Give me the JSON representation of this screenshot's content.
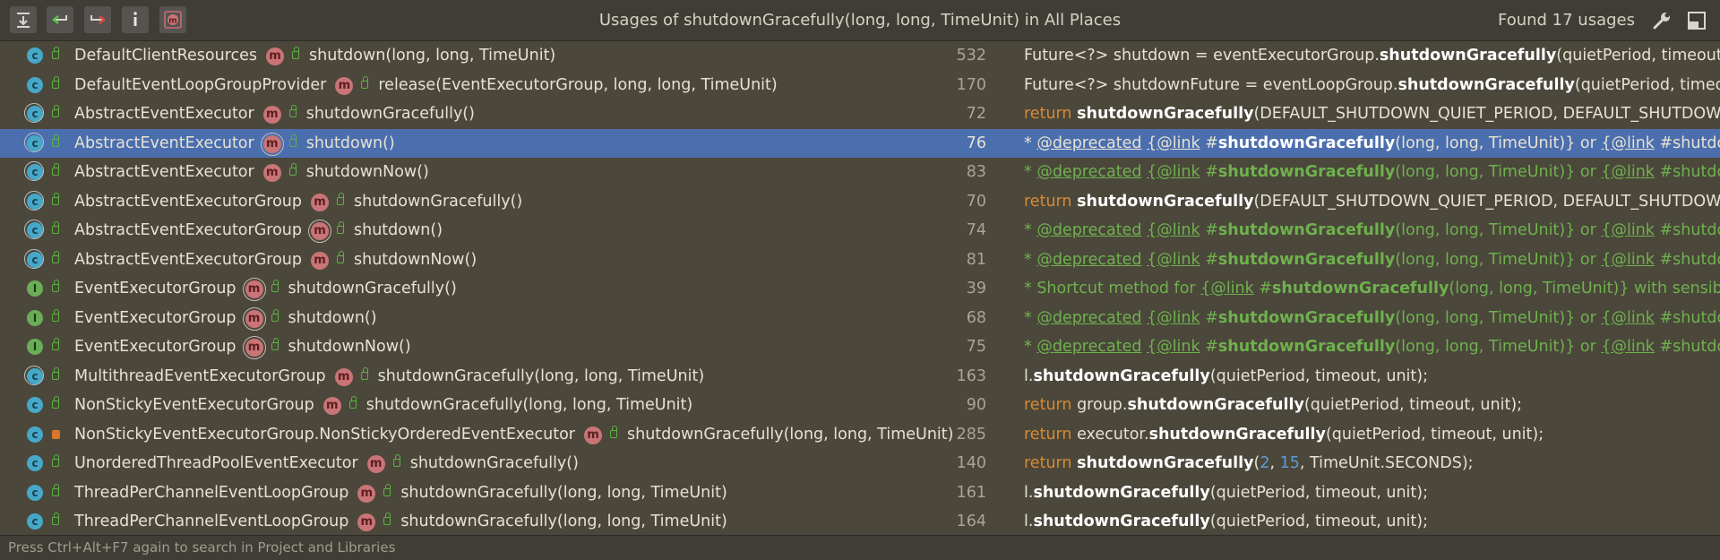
{
  "header": {
    "title": "Usages of shutdownGracefully(long, long, TimeUnit) in All Places",
    "found": "Found 17 usages",
    "toolbar": [
      {
        "name": "expand-all-icon"
      },
      {
        "name": "previous-occurrence-icon"
      },
      {
        "name": "next-occurrence-icon"
      },
      {
        "name": "info-icon"
      },
      {
        "name": "filter-method-icon"
      }
    ],
    "settings_icon": "wrench-icon",
    "pin_icon": "restore-layout-icon"
  },
  "rows": [
    {
      "icon": "c",
      "ab": false,
      "lock": "green",
      "cls": "DefaultClientResources",
      "micon_ab": false,
      "method": "shutdown(long, long, TimeUnit)",
      "line": "532",
      "code": [
        {
          "t": "Future<?> shutdown = eventExecutorGroup."
        },
        {
          "t": "shutdownGracefully",
          "s": "bold"
        },
        {
          "t": "(quietPeriod, timeout, timeUnit);"
        }
      ]
    },
    {
      "icon": "c",
      "ab": false,
      "lock": "green",
      "cls": "DefaultEventLoopGroupProvider",
      "micon_ab": false,
      "method": "release(EventExecutorGroup, long, long, TimeUnit)",
      "line": "170",
      "code": [
        {
          "t": "Future<?> shutdownFuture = eventLoopGroup."
        },
        {
          "t": "shutdownGracefully",
          "s": "bold"
        },
        {
          "t": "(quietPeriod, timeout, unit);"
        }
      ]
    },
    {
      "icon": "c",
      "ab": true,
      "lock": "green",
      "cls": "AbstractEventExecutor",
      "micon_ab": false,
      "method": "shutdownGracefully()",
      "line": "72",
      "code": [
        {
          "t": "return ",
          "s": "kw"
        },
        {
          "t": "shutdownGracefully",
          "s": "bold"
        },
        {
          "t": "(DEFAULT_SHUTDOWN_QUIET_PERIOD, DEFAULT_SHUTDOWN_TIMEOUT, TimeUnit.SECONDS);"
        }
      ]
    },
    {
      "icon": "c",
      "ab": true,
      "lock": "green",
      "cls": "AbstractEventExecutor",
      "micon_ab": true,
      "method": "shutdown()",
      "line": "76",
      "selected": true,
      "code": [
        {
          "t": "* "
        },
        {
          "t": "@deprecated",
          "s": "u"
        },
        {
          "t": " "
        },
        {
          "t": "{@link",
          "s": "u"
        },
        {
          "t": " #"
        },
        {
          "t": "shutdownGracefully",
          "s": "bold"
        },
        {
          "t": "(long, long, TimeUnit)} or "
        },
        {
          "t": "{@link",
          "s": "u"
        },
        {
          "t": " #shutdownGracefully()}."
        }
      ]
    },
    {
      "icon": "c",
      "ab": true,
      "lock": "green",
      "cls": "AbstractEventExecutor",
      "micon_ab": false,
      "method": "shutdownNow()",
      "line": "83",
      "code": [
        {
          "t": "* ",
          "s": "cm"
        },
        {
          "t": "@deprecated",
          "s": "tag"
        },
        {
          "t": " ",
          "s": "cm"
        },
        {
          "t": "{@link",
          "s": "tag"
        },
        {
          "t": " #",
          "s": "cm"
        },
        {
          "t": "shutdownGracefully",
          "s": "cmb"
        },
        {
          "t": "(long, long, TimeUnit)} or ",
          "s": "cm"
        },
        {
          "t": "{@link",
          "s": "tag"
        },
        {
          "t": " #shutdownGracefully()}.",
          "s": "cm"
        }
      ]
    },
    {
      "icon": "c",
      "ab": true,
      "lock": "green",
      "cls": "AbstractEventExecutorGroup",
      "micon_ab": false,
      "method": "shutdownGracefully()",
      "line": "70",
      "code": [
        {
          "t": "return ",
          "s": "kw"
        },
        {
          "t": "shutdownGracefully",
          "s": "bold"
        },
        {
          "t": "(DEFAULT_SHUTDOWN_QUIET_PERIOD, DEFAULT_SHUTDOWN_TIMEOUT, TimeUnit.SECONDS);"
        }
      ]
    },
    {
      "icon": "c",
      "ab": true,
      "lock": "green",
      "cls": "AbstractEventExecutorGroup",
      "micon_ab": true,
      "method": "shutdown()",
      "line": "74",
      "code": [
        {
          "t": "* ",
          "s": "cm"
        },
        {
          "t": "@deprecated",
          "s": "tag"
        },
        {
          "t": " ",
          "s": "cm"
        },
        {
          "t": "{@link",
          "s": "tag"
        },
        {
          "t": " #",
          "s": "cm"
        },
        {
          "t": "shutdownGracefully",
          "s": "cmb"
        },
        {
          "t": "(long, long, TimeUnit)} or ",
          "s": "cm"
        },
        {
          "t": "{@link",
          "s": "tag"
        },
        {
          "t": " #shutdownGracefully()}.",
          "s": "cm"
        }
      ]
    },
    {
      "icon": "c",
      "ab": true,
      "lock": "green",
      "cls": "AbstractEventExecutorGroup",
      "micon_ab": false,
      "method": "shutdownNow()",
      "line": "81",
      "code": [
        {
          "t": "* ",
          "s": "cm"
        },
        {
          "t": "@deprecated",
          "s": "tag"
        },
        {
          "t": " ",
          "s": "cm"
        },
        {
          "t": "{@link",
          "s": "tag"
        },
        {
          "t": " #",
          "s": "cm"
        },
        {
          "t": "shutdownGracefully",
          "s": "cmb"
        },
        {
          "t": "(long, long, TimeUnit)} or ",
          "s": "cm"
        },
        {
          "t": "{@link",
          "s": "tag"
        },
        {
          "t": " #shutdownGracefully()}.",
          "s": "cm"
        }
      ]
    },
    {
      "icon": "i",
      "ab": false,
      "lock": "green",
      "cls": "EventExecutorGroup",
      "micon_ab": true,
      "method": "shutdownGracefully()",
      "line": "39",
      "code": [
        {
          "t": "* Shortcut method for ",
          "s": "cm"
        },
        {
          "t": "{@link",
          "s": "tag"
        },
        {
          "t": " #",
          "s": "cm"
        },
        {
          "t": "shutdownGracefully",
          "s": "cmb"
        },
        {
          "t": "(long, long, TimeUnit)} with sensible default values.",
          "s": "cm"
        }
      ]
    },
    {
      "icon": "i",
      "ab": false,
      "lock": "green",
      "cls": "EventExecutorGroup",
      "micon_ab": true,
      "method": "shutdown()",
      "line": "68",
      "code": [
        {
          "t": "* ",
          "s": "cm"
        },
        {
          "t": "@deprecated",
          "s": "tag"
        },
        {
          "t": " ",
          "s": "cm"
        },
        {
          "t": "{@link",
          "s": "tag"
        },
        {
          "t": " #",
          "s": "cm"
        },
        {
          "t": "shutdownGracefully",
          "s": "cmb"
        },
        {
          "t": "(long, long, TimeUnit)} or ",
          "s": "cm"
        },
        {
          "t": "{@link",
          "s": "tag"
        },
        {
          "t": " #shutdownGracefully()}.",
          "s": "cm"
        }
      ]
    },
    {
      "icon": "i",
      "ab": false,
      "lock": "green",
      "cls": "EventExecutorGroup",
      "micon_ab": true,
      "method": "shutdownNow()",
      "line": "75",
      "code": [
        {
          "t": "* ",
          "s": "cm"
        },
        {
          "t": "@deprecated",
          "s": "tag"
        },
        {
          "t": " ",
          "s": "cm"
        },
        {
          "t": "{@link",
          "s": "tag"
        },
        {
          "t": " #",
          "s": "cm"
        },
        {
          "t": "shutdownGracefully",
          "s": "cmb"
        },
        {
          "t": "(long, long, TimeUnit)} or ",
          "s": "cm"
        },
        {
          "t": "{@link",
          "s": "tag"
        },
        {
          "t": " #shutdownGracefully()}.",
          "s": "cm"
        }
      ]
    },
    {
      "icon": "c",
      "ab": true,
      "lock": "green",
      "cls": "MultithreadEventExecutorGroup",
      "micon_ab": false,
      "method": "shutdownGracefully(long, long, TimeUnit)",
      "line": "163",
      "code": [
        {
          "t": "l."
        },
        {
          "t": "shutdownGracefully",
          "s": "bold"
        },
        {
          "t": "(quietPeriod, timeout, unit);"
        }
      ]
    },
    {
      "icon": "c",
      "ab": false,
      "lock": "green",
      "cls": "NonStickyEventExecutorGroup",
      "micon_ab": false,
      "method": "shutdownGracefully(long, long, TimeUnit)",
      "line": "90",
      "code": [
        {
          "t": "return ",
          "s": "kw"
        },
        {
          "t": "group."
        },
        {
          "t": "shutdownGracefully",
          "s": "bold"
        },
        {
          "t": "(quietPeriod, timeout, unit);"
        }
      ]
    },
    {
      "icon": "c",
      "ab": false,
      "lock": "orange",
      "cls": "NonStickyEventExecutorGroup.NonStickyOrderedEventExecutor",
      "micon_ab": false,
      "method": "shutdownGracefully(long, long, TimeUnit)",
      "line": "285",
      "code": [
        {
          "t": "return ",
          "s": "kw"
        },
        {
          "t": "executor."
        },
        {
          "t": "shutdownGracefully",
          "s": "bold"
        },
        {
          "t": "(quietPeriod, timeout, unit);"
        }
      ]
    },
    {
      "icon": "c",
      "ab": false,
      "lock": "green",
      "cls": "UnorderedThreadPoolEventExecutor",
      "micon_ab": false,
      "method": "shutdownGracefully()",
      "line": "140",
      "code": [
        {
          "t": "return ",
          "s": "kw"
        },
        {
          "t": "shutdownGracefully",
          "s": "bold"
        },
        {
          "t": "("
        },
        {
          "t": "2",
          "s": "num"
        },
        {
          "t": ", "
        },
        {
          "t": "15",
          "s": "num"
        },
        {
          "t": ", TimeUnit.SECONDS);"
        }
      ]
    },
    {
      "icon": "c",
      "ab": false,
      "lock": "green",
      "cls": "ThreadPerChannelEventLoopGroup",
      "micon_ab": false,
      "method": "shutdownGracefully(long, long, TimeUnit)",
      "line": "161",
      "code": [
        {
          "t": "l."
        },
        {
          "t": "shutdownGracefully",
          "s": "bold"
        },
        {
          "t": "(quietPeriod, timeout, unit);"
        }
      ]
    },
    {
      "icon": "c",
      "ab": false,
      "lock": "green",
      "cls": "ThreadPerChannelEventLoopGroup",
      "micon_ab": false,
      "method": "shutdownGracefully(long, long, TimeUnit)",
      "line": "164",
      "code": [
        {
          "t": "l."
        },
        {
          "t": "shutdownGracefully",
          "s": "bold"
        },
        {
          "t": "(quietPeriod, timeout, unit);"
        }
      ]
    }
  ],
  "status": "Press Ctrl+Alt+F7 again to search in Project and Libraries",
  "colors": {
    "background": "#4b473b",
    "selection": "#4b6eaf",
    "keyword": "#d78a32",
    "comment": "#6fb14e",
    "number": "#5f9bd6"
  }
}
